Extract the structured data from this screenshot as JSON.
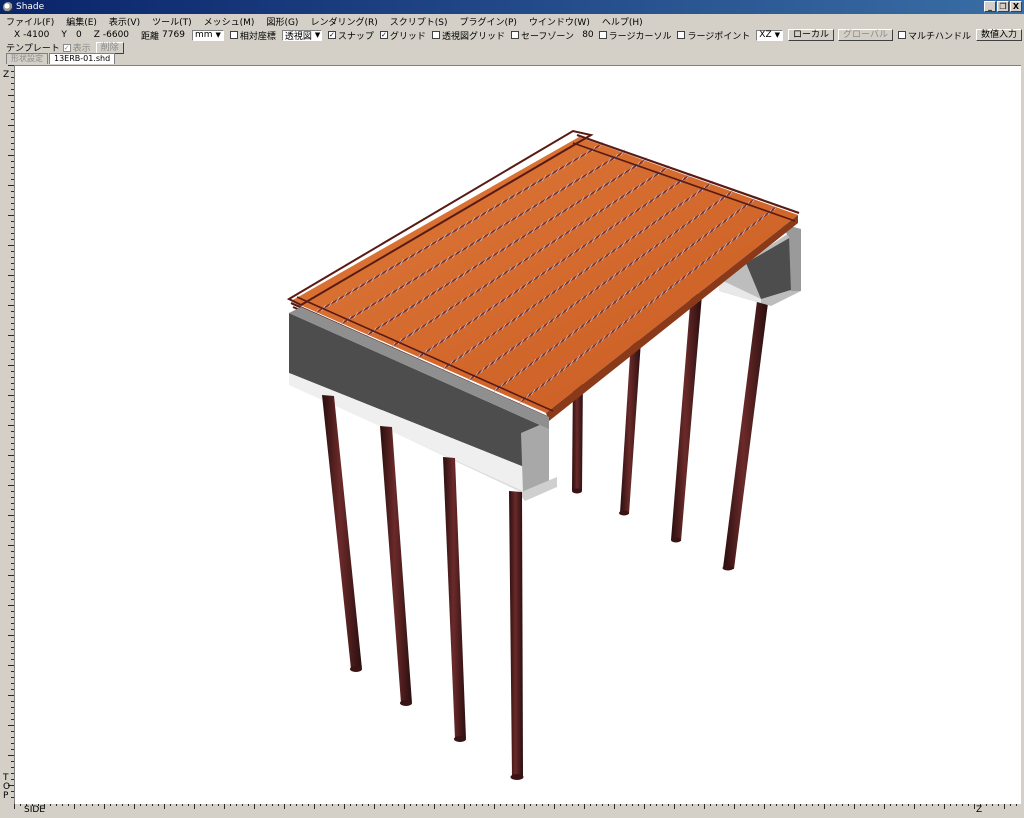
{
  "window": {
    "title": "Shade",
    "minimize": "_",
    "restore": "❐",
    "close": "X"
  },
  "menu": [
    "ファイル(F)",
    "編集(E)",
    "表示(V)",
    "ツール(T)",
    "メッシュ(M)",
    "図形(G)",
    "レンダリング(R)",
    "スクリプト(S)",
    "プラグイン(P)",
    "ウインドウ(W)",
    "ヘルプ(H)"
  ],
  "coords": {
    "x_label": "X",
    "x_value": "-4100",
    "y_label": "Y",
    "y_value": "0",
    "z_label": "Z",
    "z_value": "-6600",
    "dist_label": "距離",
    "dist_value": "7769",
    "unit": "mm",
    "relative_label": "相対座標",
    "view_mode": "透視図",
    "snap_label": "スナップ",
    "grid_label": "グリッド",
    "persp_grid_label": "透視図グリッド",
    "safe_zone_label": "セーフゾーン",
    "safe_zone_value": "80",
    "large_cursor_label": "ラージカーソル",
    "large_point_label": "ラージポイント",
    "plane": "XZ",
    "local_btn": "ローカル",
    "global_btn": "グローバル",
    "multi_handle_label": "マルチハンドル",
    "numeric_btn": "数値入力"
  },
  "template": {
    "label": "テンプレート",
    "show_label": "表示",
    "delete_btn": "削除"
  },
  "tabs": [
    {
      "label": "形状設定"
    },
    {
      "label": "13ERB-01.shd"
    }
  ],
  "axes": {
    "top_left": "Z",
    "bottom_left": [
      "T",
      "O",
      "P"
    ],
    "bottom_side": "SIDE",
    "bottom_right": "Z"
  },
  "colors": {
    "titlebar": "#0a246a",
    "deck": "#d5682c",
    "rebar": "#7a2a22",
    "concrete": "#4d4d4d",
    "pile": "#4a1c1c"
  },
  "icons": {
    "dropdown": "▼",
    "check": "✓"
  }
}
